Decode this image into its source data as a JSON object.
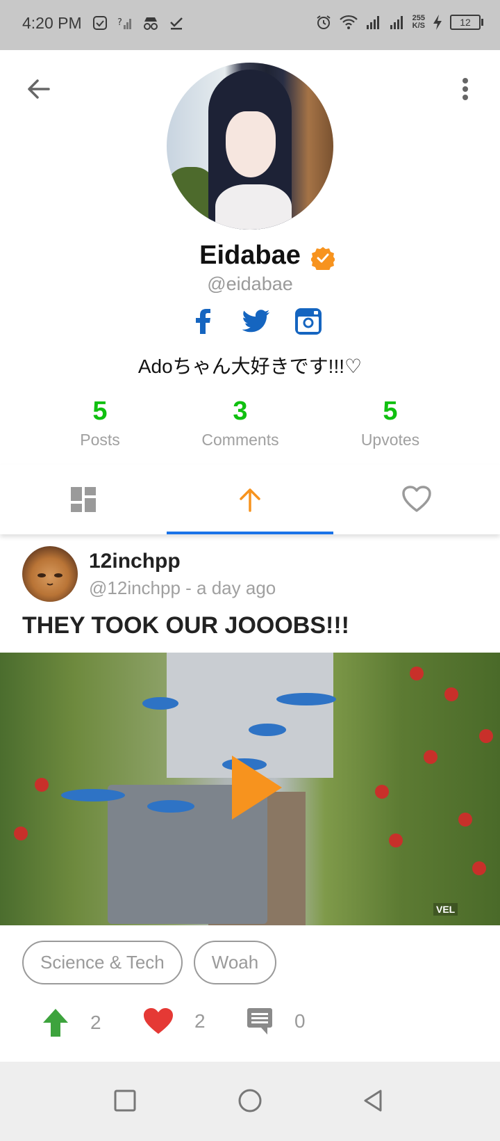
{
  "status_bar": {
    "time": "4:20 PM",
    "net_speed_value": "255",
    "net_speed_unit": "K/S",
    "battery_level": "12"
  },
  "profile": {
    "display_name": "Eidabae",
    "handle": "@eidabae",
    "bio": "Adoちゃん大好きです!!!♡",
    "verified": true,
    "social_links": [
      "facebook-icon",
      "twitter-icon",
      "instagram-icon"
    ],
    "stats": [
      {
        "value": "5",
        "label": "Posts"
      },
      {
        "value": "3",
        "label": "Comments"
      },
      {
        "value": "5",
        "label": "Upvotes"
      }
    ]
  },
  "tabs": [
    {
      "icon": "dashboard-icon",
      "active": false
    },
    {
      "icon": "upvote-arrow-icon",
      "active": true
    },
    {
      "icon": "heart-outline-icon",
      "active": false
    }
  ],
  "post": {
    "username": "12inchpp",
    "meta": "@12inchpp - a day ago",
    "title": "THEY TOOK OUR JOOOBS!!!",
    "video_watermark": "VEL",
    "tags": [
      "Science & Tech",
      "Woah"
    ],
    "upvotes": "2",
    "likes": "2",
    "comments": "0"
  },
  "colors": {
    "accent_green": "#10c010",
    "tab_orange": "#f7931e",
    "tab_underline_blue": "#1a73e8",
    "social_blue": "#1565c0",
    "upvote_green": "#3da33d",
    "heart_red": "#e53935"
  }
}
